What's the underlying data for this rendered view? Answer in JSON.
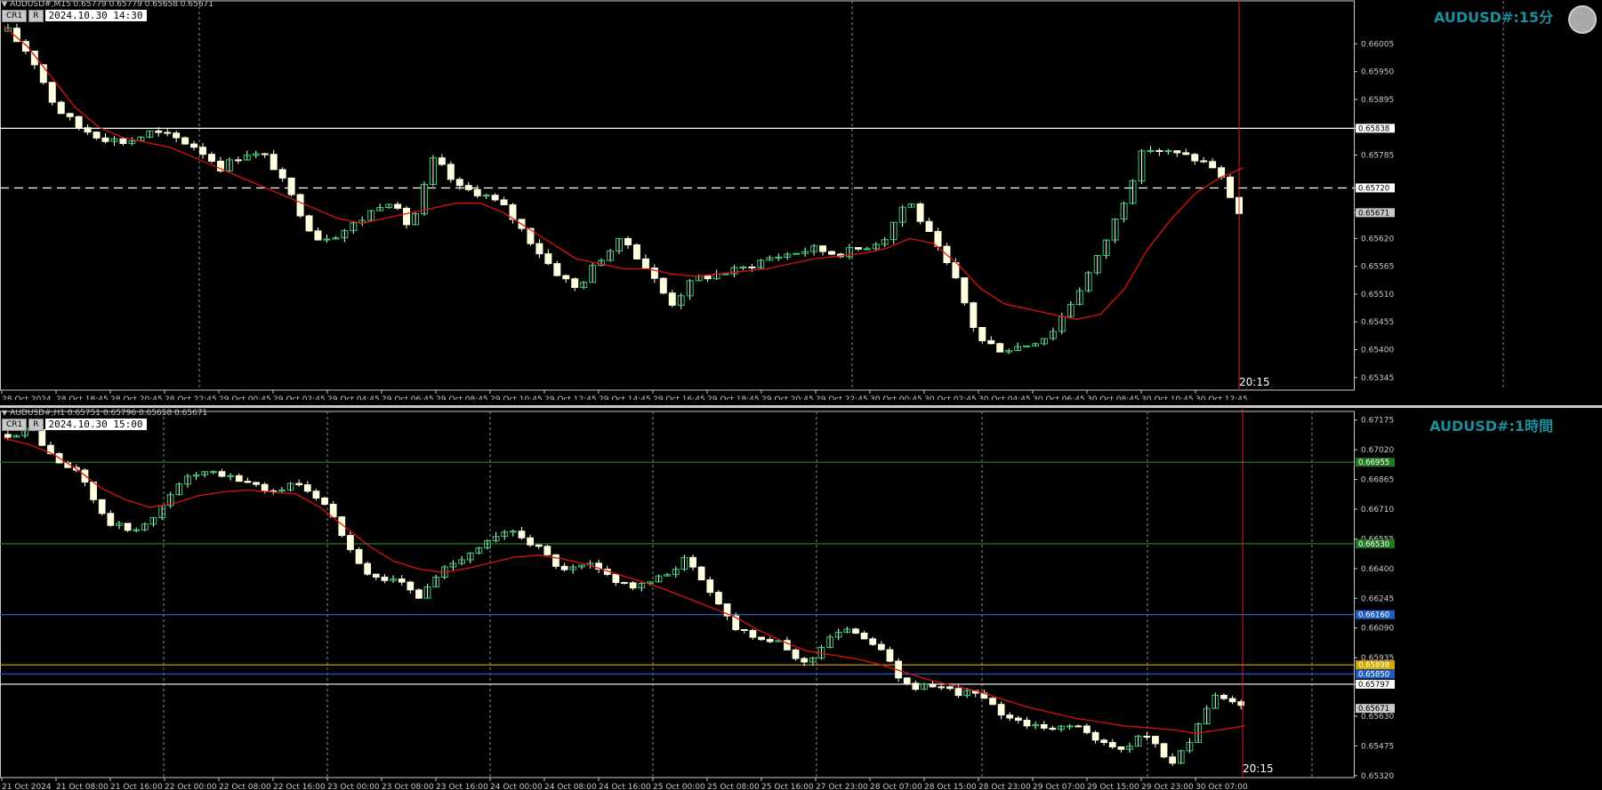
{
  "panel_m15": {
    "header": "AUDUSD#,M15  0.65779 0.65779 0.65658 0.65671",
    "btn1": "CR1",
    "btn2": "R",
    "datetime": "2024.10.30 14:30",
    "symbol": "AUDUSD#:15分",
    "time_marker": "20:15"
  },
  "panel_h1": {
    "header": "AUDUSD#,H1  0.65751 0.65796 0.65658 0.65671",
    "btn1": "CR1",
    "btn2": "R",
    "datetime": "2024.10.30 15:00",
    "symbol": "AUDUSD#:1時間",
    "time_marker": "20:15"
  },
  "chart_data": [
    {
      "type": "candlestick",
      "timeframe": "M15",
      "ylim": [
        0.6532,
        0.6609
      ],
      "y_ticks": [
        "0.66005",
        "0.65950",
        "0.65895",
        "0.65838",
        "0.65785",
        "0.65720",
        "0.65671",
        "0.65620",
        "0.65565",
        "0.65510",
        "0.65455",
        "0.65400",
        "0.65345"
      ],
      "x_ticks": [
        "28 Oct 2024",
        "28 Oct 18:45",
        "28 Oct 20:45",
        "28 Oct 22:45",
        "29 Oct 00:45",
        "29 Oct 02:45",
        "29 Oct 04:45",
        "29 Oct 06:45",
        "29 Oct 08:45",
        "29 Oct 10:45",
        "29 Oct 12:45",
        "29 Oct 14:45",
        "29 Oct 16:45",
        "29 Oct 18:45",
        "29 Oct 20:45",
        "29 Oct 22:45",
        "30 Oct 00:45",
        "30 Oct 02:45",
        "30 Oct 04:45",
        "30 Oct 06:45",
        "30 Oct 08:45",
        "30 Oct 10:45",
        "30 Oct 12:45"
      ],
      "price_path": [
        0.6603,
        0.6598,
        0.6588,
        0.6584,
        0.6582,
        0.6581,
        0.6583,
        0.6582,
        0.658,
        0.6576,
        0.6579,
        0.6578,
        0.657,
        0.6562,
        0.6563,
        0.6566,
        0.657,
        0.6564,
        0.6578,
        0.6572,
        0.6571,
        0.6568,
        0.6562,
        0.6556,
        0.6552,
        0.6558,
        0.6562,
        0.6556,
        0.6549,
        0.6554,
        0.6555,
        0.6556,
        0.6558,
        0.6559,
        0.656,
        0.6559,
        0.656,
        0.6562,
        0.657,
        0.6562,
        0.6554,
        0.6542,
        0.654,
        0.6541,
        0.6543,
        0.655,
        0.6558,
        0.6568,
        0.658,
        0.6579,
        0.6578,
        0.6576,
        0.65671
      ],
      "ma_path": [
        0.6604,
        0.66,
        0.6594,
        0.6588,
        0.6584,
        0.6582,
        0.6581,
        0.658,
        0.6578,
        0.6576,
        0.6574,
        0.6572,
        0.657,
        0.6568,
        0.6566,
        0.6565,
        0.6566,
        0.6567,
        0.6568,
        0.6569,
        0.6569,
        0.6567,
        0.6564,
        0.6561,
        0.6558,
        0.6557,
        0.6556,
        0.6556,
        0.6555,
        0.65545,
        0.6555,
        0.65555,
        0.6556,
        0.6557,
        0.6558,
        0.65585,
        0.6559,
        0.656,
        0.6562,
        0.6561,
        0.6557,
        0.6552,
        0.6549,
        0.6548,
        0.6547,
        0.6546,
        0.6547,
        0.6552,
        0.656,
        0.6566,
        0.6571,
        0.6574,
        0.6576
      ],
      "hlines": [
        {
          "label": "0.65838",
          "value": 0.65838,
          "color": "#ffffff",
          "style": "solid"
        },
        {
          "label": "0.65720",
          "value": 0.6572,
          "color": "#ffffff",
          "style": "dashed"
        }
      ],
      "current_price": "0.65671"
    },
    {
      "type": "candlestick",
      "timeframe": "H1",
      "ylim": [
        0.6531,
        0.6722
      ],
      "y_ticks": [
        "0.67175",
        "0.67020",
        "0.66865",
        "0.66710",
        "0.66555",
        "0.66400",
        "0.66245",
        "0.66090",
        "0.65935",
        "0.65797",
        "0.65630",
        "0.65475",
        "0.65320"
      ],
      "x_ticks": [
        "21 Oct 2024",
        "21 Oct 08:00",
        "21 Oct 16:00",
        "22 Oct 00:00",
        "22 Oct 08:00",
        "22 Oct 16:00",
        "23 Oct 00:00",
        "23 Oct 08:00",
        "23 Oct 16:00",
        "24 Oct 00:00",
        "24 Oct 08:00",
        "24 Oct 16:00",
        "25 Oct 00:00",
        "25 Oct 08:00",
        "25 Oct 16:00",
        "27 Oct 23:00",
        "28 Oct 07:00",
        "28 Oct 15:00",
        "28 Oct 23:00",
        "29 Oct 07:00",
        "29 Oct 15:00",
        "29 Oct 23:00",
        "30 Oct 07:00"
      ],
      "price_path": [
        0.671,
        0.6713,
        0.6695,
        0.669,
        0.6665,
        0.666,
        0.6665,
        0.6685,
        0.669,
        0.6688,
        0.6685,
        0.668,
        0.6685,
        0.6675,
        0.6655,
        0.6635,
        0.6635,
        0.6625,
        0.664,
        0.6648,
        0.6655,
        0.666,
        0.665,
        0.6638,
        0.6642,
        0.6635,
        0.663,
        0.6635,
        0.6645,
        0.663,
        0.661,
        0.6605,
        0.66,
        0.659,
        0.6605,
        0.6608,
        0.66,
        0.658,
        0.6578,
        0.6576,
        0.6575,
        0.6565,
        0.656,
        0.6555,
        0.656,
        0.655,
        0.6545,
        0.6555,
        0.6538,
        0.6552,
        0.6575,
        0.65671
      ],
      "ma_path": [
        0.6708,
        0.6705,
        0.67,
        0.6692,
        0.6682,
        0.6676,
        0.6672,
        0.6674,
        0.6678,
        0.668,
        0.6681,
        0.668,
        0.6679,
        0.6672,
        0.6662,
        0.6652,
        0.6644,
        0.664,
        0.6638,
        0.664,
        0.6643,
        0.6646,
        0.6647,
        0.6645,
        0.6642,
        0.6638,
        0.6634,
        0.663,
        0.6625,
        0.662,
        0.6615,
        0.6608,
        0.6602,
        0.6597,
        0.6595,
        0.6593,
        0.659,
        0.6586,
        0.6582,
        0.6579,
        0.6576,
        0.6572,
        0.6568,
        0.6565,
        0.6562,
        0.656,
        0.6558,
        0.6557,
        0.6556,
        0.6554,
        0.6556,
        0.6558
      ],
      "hlines": [
        {
          "label": "0.66955",
          "value": 0.66955,
          "color": "#1f7a1f",
          "style": "solid"
        },
        {
          "label": "0.66530",
          "value": 0.6653,
          "color": "#1f7a1f",
          "style": "solid"
        },
        {
          "label": "0.66160",
          "value": 0.6616,
          "color": "#1f5fbf",
          "style": "solid"
        },
        {
          "label": "0.65898",
          "value": 0.65898,
          "color": "#d4a800",
          "style": "solid"
        },
        {
          "label": "0.65850",
          "value": 0.6585,
          "color": "#1f5fbf",
          "style": "solid"
        },
        {
          "label": "0.65797",
          "value": 0.65797,
          "color": "#ffffff",
          "style": "solid"
        }
      ],
      "current_price": "0.65671"
    }
  ]
}
